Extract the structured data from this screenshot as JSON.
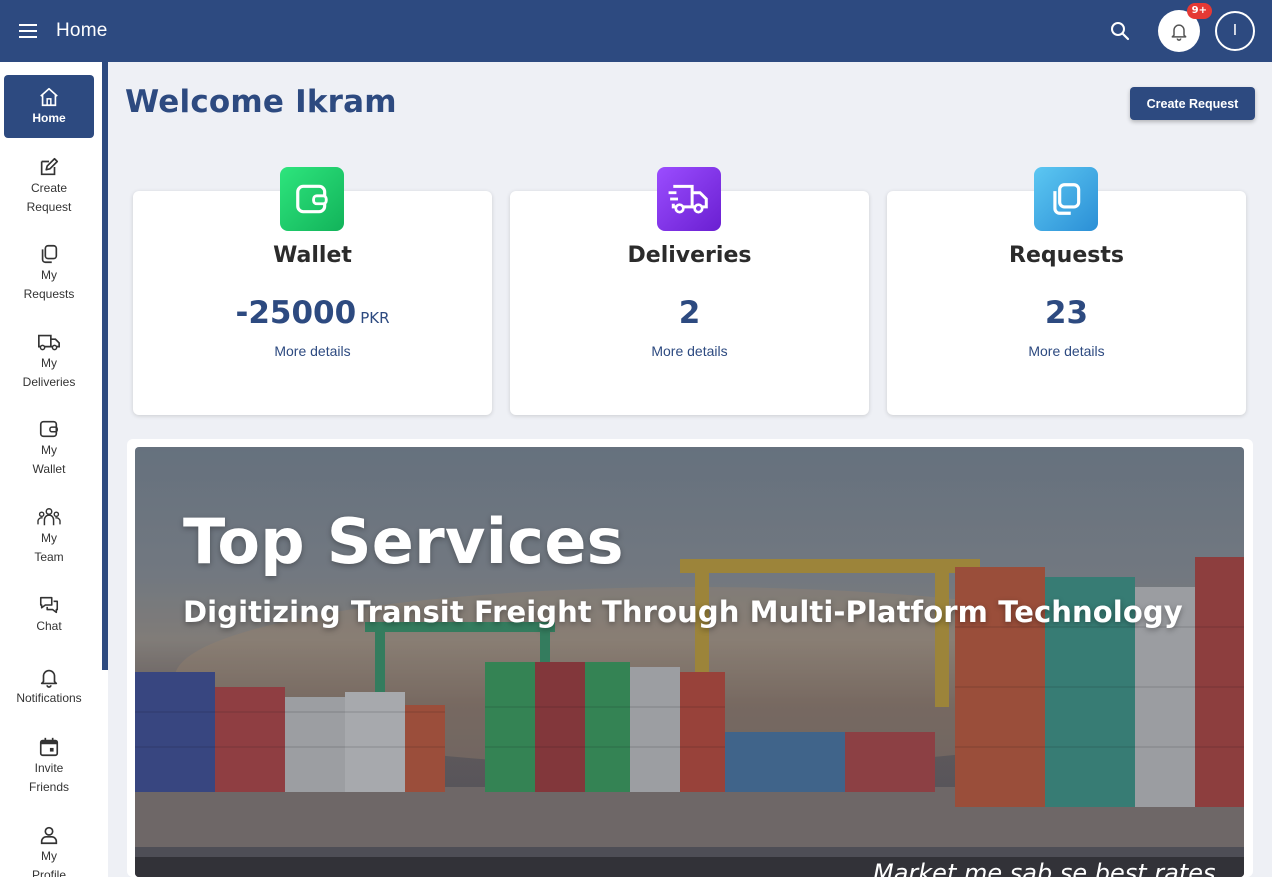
{
  "header": {
    "title": "Home",
    "notification_badge": "9+",
    "avatar_initial": "I"
  },
  "sidebar": {
    "items": [
      {
        "line1": "Home",
        "line2": "",
        "icon": "home-icon",
        "active": true
      },
      {
        "line1": "Create",
        "line2": "Request",
        "icon": "edit-icon",
        "active": false
      },
      {
        "line1": "My",
        "line2": "Requests",
        "icon": "copy-icon",
        "active": false
      },
      {
        "line1": "My",
        "line2": "Deliveries",
        "icon": "truck-icon",
        "active": false
      },
      {
        "line1": "My",
        "line2": "Wallet",
        "icon": "wallet-icon",
        "active": false
      },
      {
        "line1": "My",
        "line2": "Team",
        "icon": "team-icon",
        "active": false
      },
      {
        "line1": "Chat",
        "line2": "",
        "icon": "chat-icon",
        "active": false
      },
      {
        "line1": "Notifications",
        "line2": "",
        "icon": "bell-icon",
        "active": false
      },
      {
        "line1": "Invite",
        "line2": "Friends",
        "icon": "calendar-icon",
        "active": false
      },
      {
        "line1": "My",
        "line2": "Profile",
        "icon": "user-icon",
        "active": false
      }
    ]
  },
  "main": {
    "welcome": "Welcome Ikram",
    "create_request_label": "Create Request",
    "cards": [
      {
        "title": "Wallet",
        "value": "-25000",
        "unit": "PKR",
        "link": "More details",
        "icon": "wallet-icon",
        "color_from": "#2ee57d",
        "color_to": "#12b35a"
      },
      {
        "title": "Deliveries",
        "value": "2",
        "unit": "",
        "link": "More details",
        "icon": "truck-icon",
        "color_from": "#9b4dff",
        "color_to": "#6a1fd1"
      },
      {
        "title": "Requests",
        "value": "23",
        "unit": "",
        "link": "More details",
        "icon": "copy-icon",
        "color_from": "#5cc7f2",
        "color_to": "#2b8fd6"
      }
    ],
    "banner": {
      "title": "Top Services",
      "subtitle": "Digitizing Transit Freight Through Multi-Platform Technology",
      "footer": "Market me sab se best rates"
    }
  },
  "colors": {
    "primary": "#2d4a80",
    "badge": "#e53935"
  }
}
